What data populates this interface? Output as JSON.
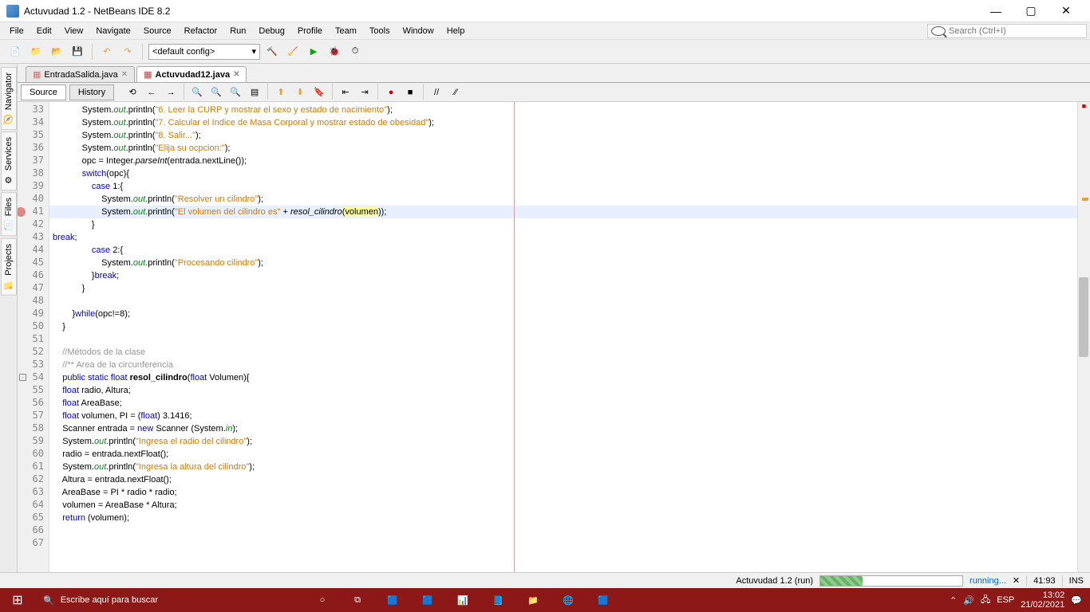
{
  "window": {
    "title": "Actuvudad 1.2 - NetBeans IDE 8.2"
  },
  "menu": {
    "file": "File",
    "edit": "Edit",
    "view": "View",
    "navigate": "Navigate",
    "source": "Source",
    "refactor": "Refactor",
    "run": "Run",
    "debug": "Debug",
    "profile": "Profile",
    "team": "Team",
    "tools": "Tools",
    "window": "Window",
    "help": "Help"
  },
  "search": {
    "placeholder": "Search (Ctrl+I)"
  },
  "toolbar": {
    "config": "<default config>"
  },
  "sidebar": {
    "navigator": "Navigator",
    "services": "Services",
    "files": "Files",
    "projects": "Projects"
  },
  "tabs": {
    "t1": "EntradaSalida.java",
    "t2": "Actuvudad12.java"
  },
  "subtabs": {
    "source": "Source",
    "history": "History"
  },
  "lines": {
    "start": 33,
    "count": 35
  },
  "code": {
    "l33a": "            System.",
    "l33b": "out",
    "l33c": ".println(",
    "l33d": "\"6. Leer la CURP y mostrar el sexo y estado de nacimiento\"",
    "l33e": ");",
    "l34a": "            System.",
    "l34b": "out",
    "l34c": ".println(",
    "l34d": "\"7. Calcular el Indice de Masa Corporal y mostrar estado de obesidad\"",
    "l34e": ");",
    "l35a": "            System.",
    "l35b": "out",
    "l35c": ".println(",
    "l35d": "\"8. Salir...\"",
    "l35e": ");",
    "l36a": "            System.",
    "l36b": "out",
    "l36c": ".println(",
    "l36d": "\"Elija su ocpcion:\"",
    "l36e": ");",
    "l37a": "            opc = Integer.",
    "l37b": "parseInt",
    "l37c": "(entrada.nextLine());",
    "l38a": "            ",
    "l38b": "switch",
    "l38c": "(opc){",
    "l39a": "                ",
    "l39b": "case",
    "l39c": " 1:{",
    "l40a": "                    System.",
    "l40b": "out",
    "l40c": ".println(",
    "l40d": "\"Resolver un cilindro\"",
    "l40e": ");",
    "l41a": "                    System.",
    "l41b": "out",
    "l41c": ".println(",
    "l41d": "\"El volumen del cilindro es\"",
    "l41e": " + ",
    "l41f": "resol_cilindro",
    "l41g": "(",
    "l41h": "volumen",
    "l41i": "));",
    "l42a": "                }",
    "l43a": "break",
    "l43b": ";",
    "l44a": "                ",
    "l44b": "case",
    "l44c": " 2:{",
    "l45a": "                    System.",
    "l45b": "out",
    "l45c": ".println(",
    "l45d": "\"Procesando cilindro\"",
    "l45e": ");",
    "l46a": "                }",
    "l46b": "break",
    "l46c": ";",
    "l47a": "            }",
    "l48a": "            ",
    "l49a": "        }",
    "l49b": "while",
    "l49c": "(opc!=8);",
    "l50a": "    }",
    "l51a": "    ",
    "l52a": "    //Métodos de la clase",
    "l53a": "    //** Area de la circunferencia",
    "l54a": "    ",
    "l54b": "public static float",
    "l54c": " ",
    "l54d": "resol_cilindro",
    "l54e": "(",
    "l54f": "float",
    "l54g": " Volumen){",
    "l55a": "    ",
    "l55b": "float",
    "l55c": " radio, Altura;",
    "l56a": "    ",
    "l56b": "float",
    "l56c": " AreaBase;",
    "l57a": "    ",
    "l57b": "float",
    "l57c": " volumen, PI = (",
    "l57d": "float",
    "l57e": ") 3.1416;",
    "l58a": "    Scanner entrada = ",
    "l58b": "new",
    "l58c": " Scanner (System.",
    "l58d": "in",
    "l58e": ");",
    "l59a": "    System.",
    "l59b": "out",
    "l59c": ".println(",
    "l59d": "\"Ingresa el radio del cilindro\"",
    "l59e": ");",
    "l60a": "    radio = entrada.nextFloat();",
    "l61a": "    System.",
    "l61b": "out",
    "l61c": ".println(",
    "l61d": "\"Ingresa la altura del cilindro\"",
    "l61e": ");",
    "l62a": "    Altura = entrada.nextFloat();",
    "l63a": "    AreaBase = PI * radio * radio;",
    "l64a": "    volumen = AreaBase * Altura;",
    "l65a": "    ",
    "l65b": "return",
    "l65c": " (volumen);",
    "l66a": "    ",
    "l67a": "    "
  },
  "status": {
    "project": "Actuvudad 1.2 (run)",
    "running": "running...",
    "pos": "41:93",
    "ins": "INS"
  },
  "taskbar": {
    "search": "Escribe aquí para buscar",
    "lang": "ESP",
    "time": "13:02",
    "date": "21/02/2021"
  }
}
